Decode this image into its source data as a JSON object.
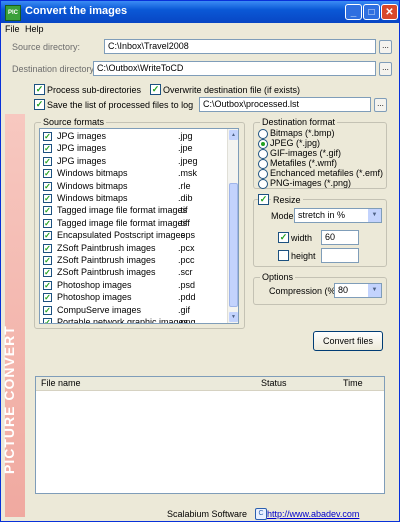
{
  "window": {
    "title": "Convert the images",
    "app_icon_text": "PIC",
    "buttons": {
      "minimize": "_",
      "maximize": "□",
      "close": "✕"
    }
  },
  "menu": {
    "file": "File",
    "help": "Help"
  },
  "paths": {
    "source_label": "Source directory:",
    "source_value": "C:\\Inbox\\Travel2008",
    "dest_label": "Destination directory:",
    "dest_value": "C:\\Outbox\\WriteToCD",
    "browse_label": "...",
    "log_value": "C:\\Outbox\\processed.lst"
  },
  "options": {
    "process_sub": "Process sub-directories",
    "overwrite": "Overwrite destination file (if exists)",
    "save_list": "Save the list of processed files to log"
  },
  "source_formats": {
    "title": "Source formats",
    "items": [
      {
        "name": "JPG images",
        "ext": ".jpg"
      },
      {
        "name": "JPG images",
        "ext": ".jpe"
      },
      {
        "name": "JPG images",
        "ext": ".jpeg"
      },
      {
        "name": "Windows bitmaps",
        "ext": ".msk"
      },
      {
        "name": "Windows bitmaps",
        "ext": ".rle"
      },
      {
        "name": "Windows bitmaps",
        "ext": ".dib"
      },
      {
        "name": "Tagged image file format images",
        "ext": ".tif"
      },
      {
        "name": "Tagged image file format images",
        "ext": ".tiff"
      },
      {
        "name": "Encapsulated Postscript images",
        "ext": ".eps"
      },
      {
        "name": "ZSoft Paintbrush images",
        "ext": ".pcx"
      },
      {
        "name": "ZSoft Paintbrush images",
        "ext": ".pcc"
      },
      {
        "name": "ZSoft Paintbrush images",
        "ext": ".scr"
      },
      {
        "name": "Photoshop images",
        "ext": ".psd"
      },
      {
        "name": "Photoshop images",
        "ext": ".pdd"
      },
      {
        "name": "CompuServe images",
        "ext": ".gif"
      },
      {
        "name": "Portable network graphic images",
        "ext": ".png"
      }
    ]
  },
  "destination_format": {
    "title": "Destination format",
    "options": [
      {
        "label": "Bitmaps (*.bmp)",
        "selected": false
      },
      {
        "label": "JPEG (*.jpg)",
        "selected": true
      },
      {
        "label": "GIF-images (*.gif)",
        "selected": false
      },
      {
        "label": "Metafiles (*.wmf)",
        "selected": false
      },
      {
        "label": "Enchanced metafiles (*.emf)",
        "selected": false
      },
      {
        "label": "PNG-images (*.png)",
        "selected": false
      }
    ]
  },
  "resize": {
    "label": "Resize",
    "mode_label": "Mode:",
    "mode_value": "stretch in %",
    "width_label": "width",
    "width_value": "60",
    "height_label": "height",
    "height_value": ""
  },
  "compression": {
    "title": "Options",
    "label": "Compression (%):",
    "value": "80"
  },
  "convert_button": "Convert files",
  "sidebar_text": "PICTURE CONVERT",
  "file_list": {
    "columns": [
      "File name",
      "Status",
      "Time"
    ]
  },
  "footer": {
    "company": "Scalabium Software",
    "url": "http://www.abadev.com"
  },
  "colors": {
    "titlebar": "#0a58d6",
    "window_bg": "#ece9d8",
    "sidebar": "#f0a9a0",
    "check": "#21a121"
  }
}
